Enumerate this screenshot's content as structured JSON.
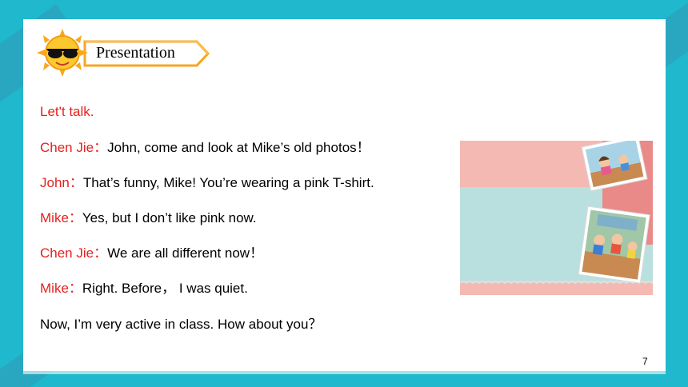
{
  "header": {
    "label": "Presentation",
    "icon": "sun-with-sunglasses-icon"
  },
  "dialogue": {
    "heading": "Let't talk.",
    "lines": [
      {
        "speaker": "Chen Jie：",
        "text": "John, come and look at Mike’s old photos！"
      },
      {
        "speaker": "John：",
        "text": "That’s funny, Mike! You’re wearing a pink T-shirt."
      },
      {
        "speaker": "Mike：",
        "text": "Yes, but I don’t like pink now."
      },
      {
        "speaker": "Chen Jie：",
        "text": "We are all different  now！"
      },
      {
        "speaker": "Mike：",
        "text": "Right. Before， I was quiet."
      },
      {
        "speaker": "",
        "text": "Now, I’m very active in class. How about you？"
      }
    ]
  },
  "page_number": "7",
  "colors": {
    "background": "#1fb8cc",
    "speaker": "#e62020",
    "banner_border": "#f5a623",
    "photo_bg_top": "#f4b9b2",
    "photo_bg_bottom": "#b9e0de"
  }
}
